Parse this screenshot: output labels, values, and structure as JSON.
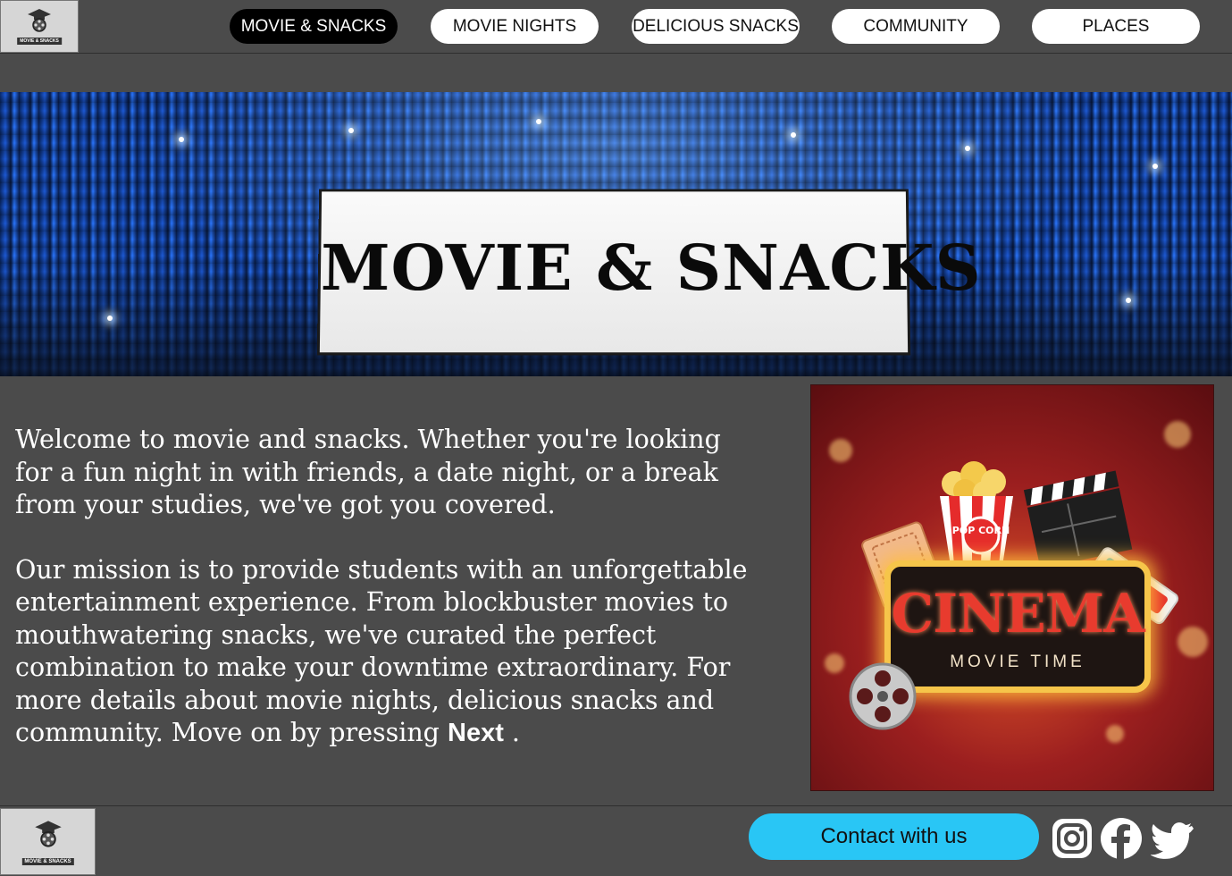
{
  "header": {
    "logo_text": "MOVIE & SNACKS",
    "nav": [
      {
        "label": "MOVIE & SNACKS",
        "active": true
      },
      {
        "label": "MOVIE NIGHTS",
        "active": false
      },
      {
        "label": "DELICIOUS SNACKS",
        "active": false
      },
      {
        "label": "COMMUNITY",
        "active": false
      },
      {
        "label": "PLACES",
        "active": false
      }
    ]
  },
  "hero": {
    "title": "MOVIE & SNACKS"
  },
  "main": {
    "paragraph1": "Welcome to movie and snacks. Whether you're looking for a fun night in with friends, a date night, or a break from your studies, we've got you covered.",
    "paragraph2_prefix": "Our mission is to provide students with an unforgettable entertainment experience. From blockbuster movies to mouthwatering snacks, we've curated the perfect combination to make your downtime extraordinary. For more details about movie nights, delicious snacks and community. Move on by pressing",
    "next_word": "Next",
    "paragraph2_suffix": ".",
    "cinema_image": {
      "title": "CINEMA",
      "subtitle": "MOVIE TIME",
      "popcorn_label": "POP CORN"
    }
  },
  "footer": {
    "logo_text": "MOVIE & SNACKS",
    "contact_label": "Contact with us",
    "social_icons": [
      "instagram-icon",
      "facebook-icon",
      "twitter-icon"
    ]
  },
  "colors": {
    "background": "#4b4b4b",
    "nav_active": "#000000",
    "nav_inactive": "#ffffff",
    "contact_button": "#29c6f5"
  }
}
